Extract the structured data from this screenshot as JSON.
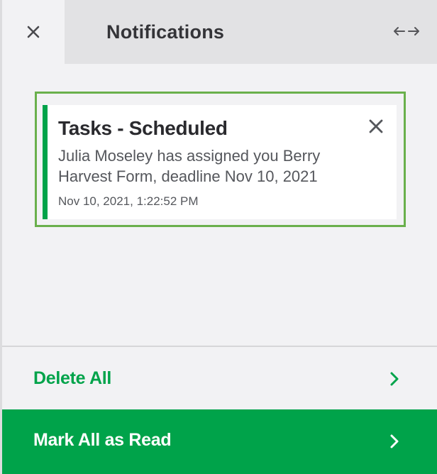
{
  "header": {
    "title": "Notifications",
    "close_icon": "close-icon",
    "expand_icon": "horizontal-arrows-icon"
  },
  "notifications": [
    {
      "title": "Tasks - Scheduled",
      "message": "Julia Moseley has assigned you Berry Harvest Form, deadline Nov 10, 2021",
      "timestamp": "Nov 10, 2021, 1:22:52 PM",
      "dismiss_icon": "close-icon"
    }
  ],
  "footer": {
    "delete_all_label": "Delete All",
    "mark_all_read_label": "Mark All as Read",
    "chevron_icon": "chevron-right-icon"
  },
  "colors": {
    "accent": "#00a34a",
    "outline": "#6ab04c",
    "background": "#f2f2f4",
    "header_bar": "#e2e2e4"
  }
}
